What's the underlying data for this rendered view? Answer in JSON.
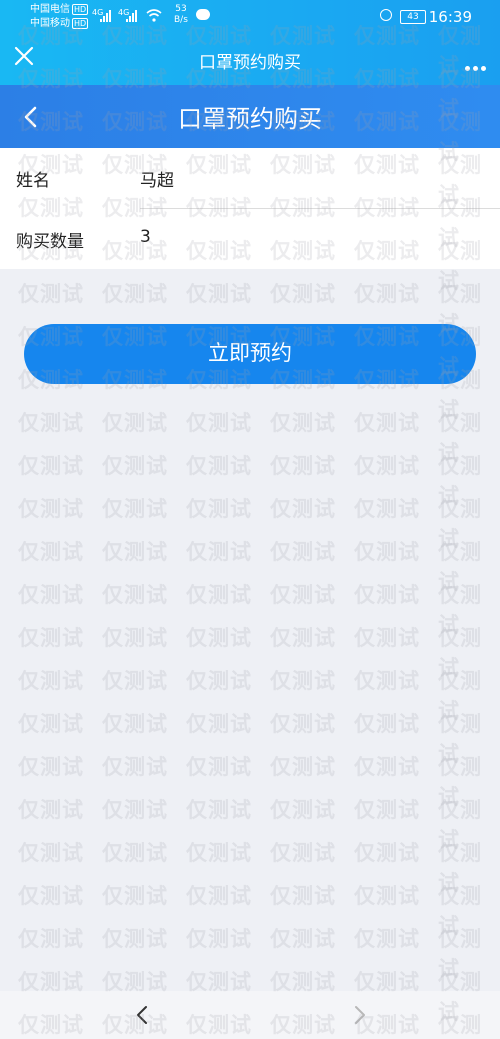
{
  "status_bar": {
    "carrier1": "中国电信",
    "carrier2": "中国移动",
    "hd_badge": "HD",
    "net_type": "4G",
    "speed_value": "53",
    "speed_unit": "B/s",
    "battery": "43",
    "time": "16:39"
  },
  "app_bar": {
    "title": "口罩预约购买"
  },
  "page_header": {
    "title": "口罩预约购买"
  },
  "form": {
    "fields": [
      {
        "label": "姓名",
        "value": "马超"
      },
      {
        "label": "购买数量",
        "value": "3"
      }
    ]
  },
  "actions": {
    "reserve_label": "立即预约"
  },
  "watermark": {
    "text": "仅测试"
  },
  "colors": {
    "topbar": "#19b8f3",
    "header": "#2f8cf0",
    "button": "#1686ee",
    "background": "#eef0f5"
  }
}
